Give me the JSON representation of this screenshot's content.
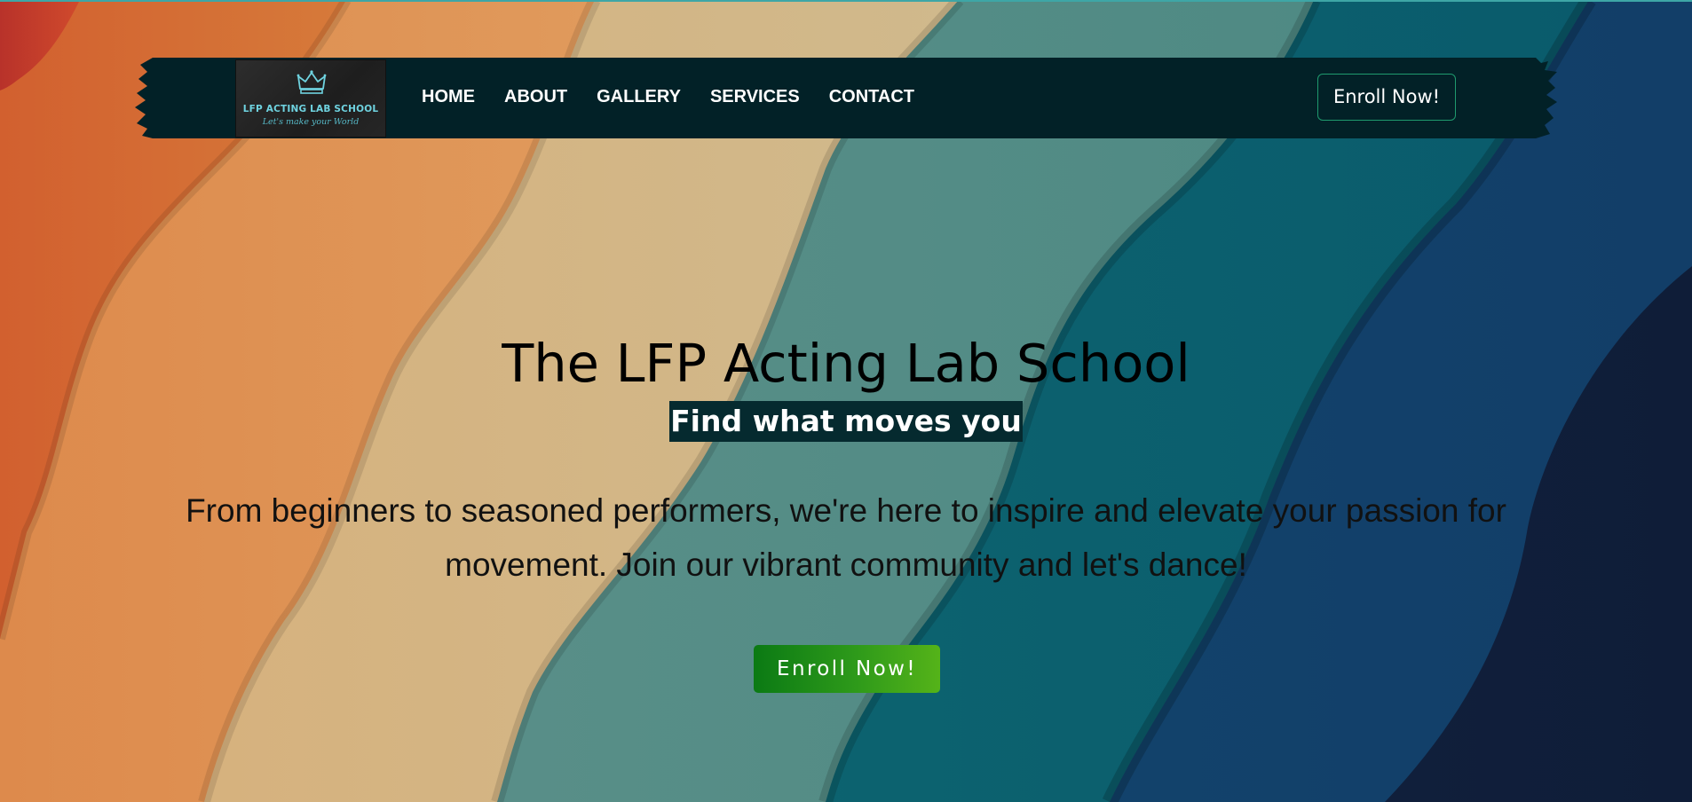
{
  "colors": {
    "navbar_bg": "#022127",
    "accent_green": "#2e9a1a",
    "enroll_border": "#1f9a6e",
    "subtitle_bg": "#052a2f",
    "logo_text": "#6fd3e0"
  },
  "navbar": {
    "logo": {
      "title": "LFP ACTING LAB SCHOOL",
      "tagline": "Let's make your World",
      "icon": "crown-icon"
    },
    "links": [
      {
        "label": "HOME"
      },
      {
        "label": "ABOUT"
      },
      {
        "label": "GALLERY"
      },
      {
        "label": "SERVICES"
      },
      {
        "label": "CONTACT"
      }
    ],
    "enroll_label": "Enroll Now!"
  },
  "hero": {
    "title": "The LFP Acting Lab School",
    "subtitle": "Find what moves you",
    "description": "From beginners to seasoned performers, we're here to inspire and elevate your passion for movement. Join our vibrant community and let's dance!",
    "enroll_label": "Enroll Now!"
  }
}
